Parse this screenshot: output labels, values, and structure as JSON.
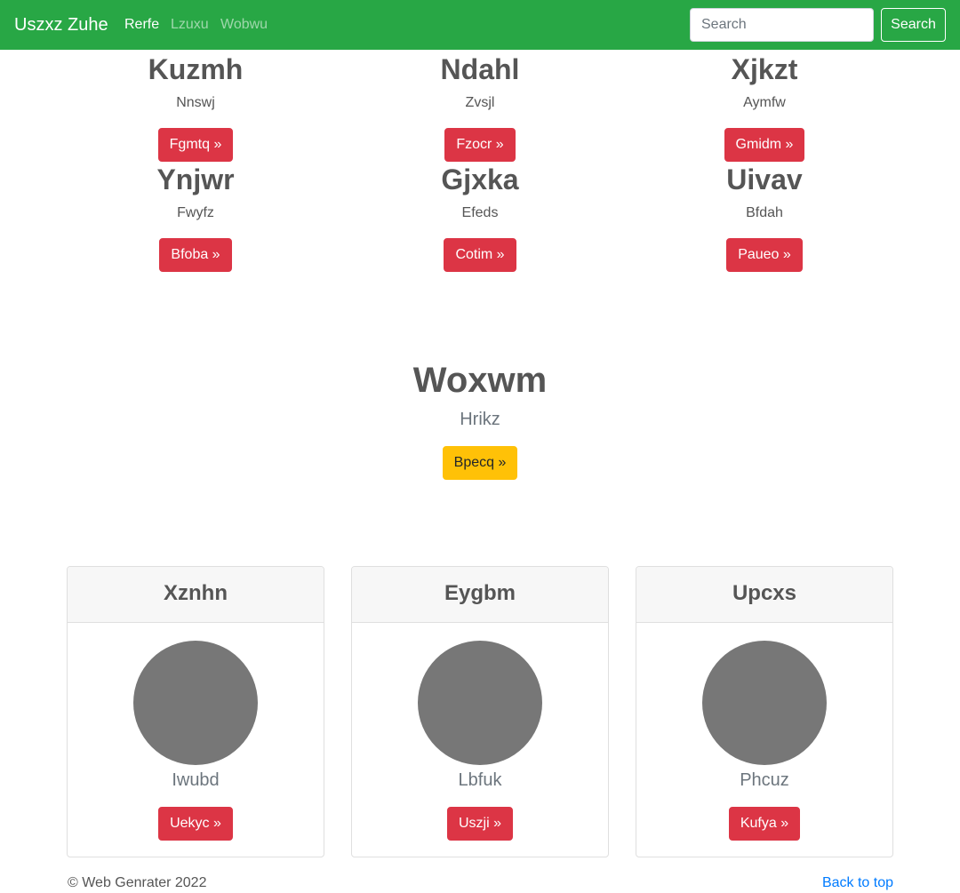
{
  "navbar": {
    "brand": "Uszxz Zuhe",
    "links": [
      {
        "label": "Rerfe",
        "active": true
      },
      {
        "label": "Lzuxu",
        "active": false
      },
      {
        "label": "Wobwu",
        "active": false
      }
    ],
    "search_placeholder": "Search",
    "search_button": "Search",
    "colors": {
      "background": "#28a745"
    }
  },
  "features": [
    {
      "title": "Kuzmh",
      "text": "Nnswj",
      "button": "Fgmtq »"
    },
    {
      "title": "Ndahl",
      "text": "Zvsjl",
      "button": "Fzocr »"
    },
    {
      "title": "Xjkzt",
      "text": "Aymfw",
      "button": "Gmidm »"
    },
    {
      "title": "Ynjwr",
      "text": "Fwyfz",
      "button": "Bfoba »"
    },
    {
      "title": "Gjxka",
      "text": "Efeds",
      "button": "Cotim »"
    },
    {
      "title": "Uivav",
      "text": "Bfdah",
      "button": "Paueo »"
    }
  ],
  "hero": {
    "title": "Woxwm",
    "subtitle": "Hrikz",
    "button": "Bpecq »"
  },
  "cards": [
    {
      "header": "Xznhn",
      "name": "Iwubd",
      "button": "Uekyc »"
    },
    {
      "header": "Eygbm",
      "name": "Lbfuk",
      "button": "Uszji »"
    },
    {
      "header": "Upcxs",
      "name": "Phcuz",
      "button": "Kufya »"
    }
  ],
  "footer": {
    "copyright": "© Web Genrater 2022",
    "back_to_top": "Back to top"
  },
  "colors": {
    "danger": "#dc3545",
    "warning": "#ffc107",
    "link": "#007bff",
    "avatar": "#777777"
  }
}
